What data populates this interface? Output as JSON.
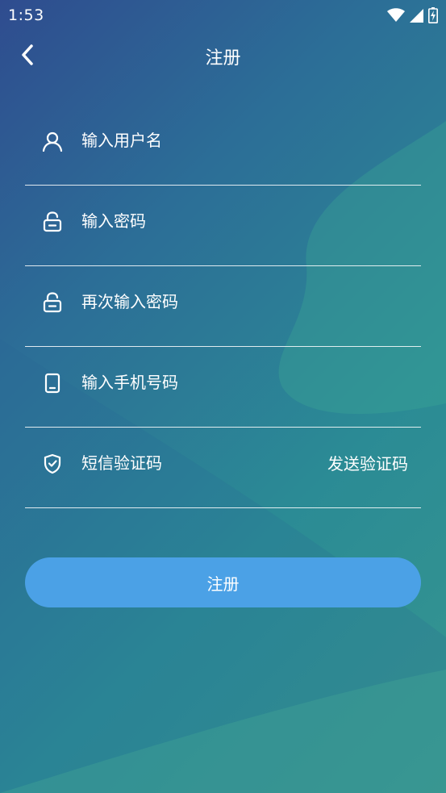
{
  "status_bar": {
    "time": "1:53",
    "icons": [
      "wifi-icon",
      "signal-icon",
      "battery-charging-icon"
    ]
  },
  "header": {
    "back_icon": "chevron-left-icon",
    "title": "注册"
  },
  "form": {
    "fields": [
      {
        "icon": "user-icon",
        "placeholder": "输入用户名",
        "value": ""
      },
      {
        "icon": "lock-icon",
        "placeholder": "输入密码",
        "value": ""
      },
      {
        "icon": "lock-icon",
        "placeholder": "再次输入密码",
        "value": ""
      },
      {
        "icon": "phone-icon",
        "placeholder": "输入手机号码",
        "value": ""
      },
      {
        "icon": "shield-check-icon",
        "placeholder": "短信验证码",
        "value": ""
      }
    ],
    "send_code_label": "发送验证码"
  },
  "submit": {
    "label": "注册"
  },
  "colors": {
    "button": "#4ba1e6",
    "gradient_start": "#2f4c8f",
    "gradient_end": "#36968f"
  }
}
